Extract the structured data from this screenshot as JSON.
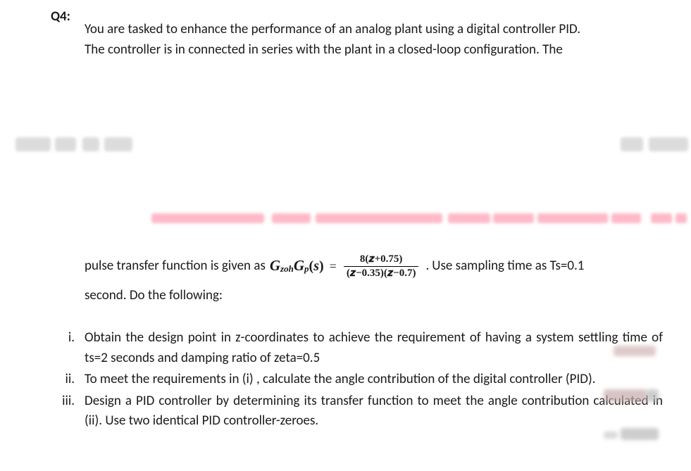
{
  "question_label": "Q4:",
  "intro_line1": "You are tasked to enhance the performance of an analog plant using a digital controller PID.",
  "intro_line2": "The controller is in connected in series with the plant in a closed-loop configuration. The",
  "pulse_prefix": "pulse transfer function is given as ",
  "formula": {
    "func_g1": "G",
    "func_sub1": "zoh",
    "func_g2": "G",
    "func_sub2": "p",
    "lparen": "(",
    "svar": "s",
    "rparen": ")",
    "equals": "=",
    "numerator": "8(𝒛+0.75)",
    "denominator": "(𝒛−0.35)(𝒛−0.7)"
  },
  "pulse_suffix_stop": ".",
  "pulse_suffix": " Use sampling time as Ts=0.1",
  "pulse_second_line": "second. Do the following:",
  "items": [
    {
      "marker": "i.",
      "text": "Obtain the design point in z-coordinates to achieve the requirement of having a system settling time of ts=2 seconds and damping ratio of zeta=0.5"
    },
    {
      "marker": "ii.",
      "text": "To meet the requirements in (i) , calculate the angle contribution of the digital controller (PID)."
    },
    {
      "marker": "iii.",
      "text": "Design a PID controller by determining its transfer function to meet the angle contribution calculated in (ii). Use two identical PID controller-zeroes."
    }
  ]
}
